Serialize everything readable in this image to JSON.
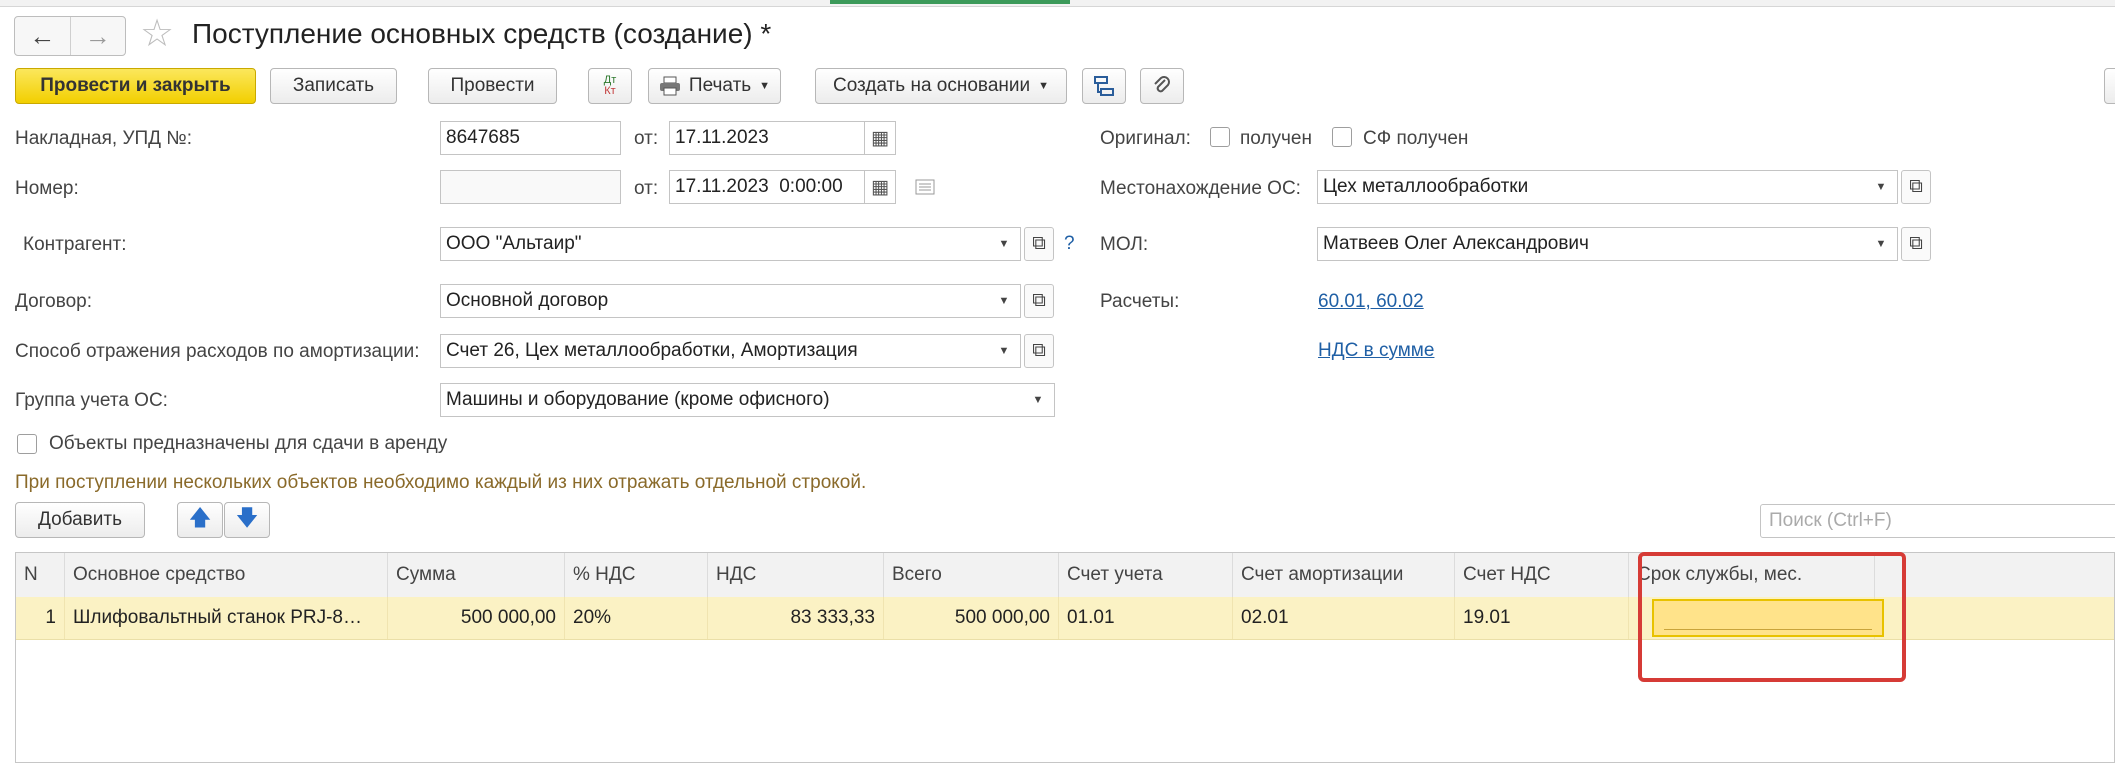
{
  "window": {
    "title": "Поступление основных средств (создание) *"
  },
  "toolbar": {
    "post_close": "Провести и закрыть",
    "save": "Записать",
    "post": "Провести",
    "dtkt_top": "Дт",
    "dtkt_bottom": "Кт",
    "print": "Печать",
    "create_based": "Создать на основании"
  },
  "form": {
    "invoice_label": "Накладная, УПД №:",
    "invoice_value": "8647685",
    "from_label": "от:",
    "invoice_date": "17.11.2023",
    "number_label": "Номер:",
    "number_value": "",
    "number_date": "17.11.2023  0:00:00",
    "counterparty_label": "Контрагент:",
    "counterparty_value": "ООО \"Альтаир\"",
    "question": "?",
    "contract_label": "Договор:",
    "contract_value": "Основной договор",
    "amort_label": "Способ отражения расходов по амортизации:",
    "amort_value": "Счет 26, Цех металлообработки, Амортизация",
    "group_label": "Группа учета ОС:",
    "group_value": "Машины и оборудование (кроме офисного)",
    "rent_label": "Объекты предназначены для сдачи в аренду",
    "original_label": "Оригинал:",
    "received_label": "получен",
    "sf_received_label": "СФ получен",
    "location_label": "Местонахождение ОС:",
    "location_value": "Цех металлообработки",
    "mol_label": "МОЛ:",
    "mol_value": "Матвеев Олег Александрович",
    "settlements_label": "Расчеты:",
    "settlements_link": "60.01, 60.02",
    "vat_link": "НДС в сумме"
  },
  "hint": "При поступлении нескольких объектов необходимо каждый из них отражать отдельной строкой.",
  "table_toolbar": {
    "add": "Добавить",
    "search_placeholder": "Поиск (Ctrl+F)"
  },
  "table": {
    "headers": [
      "N",
      "Основное средство",
      "Сумма",
      "% НДС",
      "НДС",
      "Всего",
      "Счет учета",
      "Счет амортизации",
      "Счет НДС",
      "Срок службы, мес."
    ],
    "rows": [
      [
        "1",
        "Шлифовальтный станок PRJ-8…",
        "500 000,00",
        "20%",
        "83 333,33",
        "500 000,00",
        "01.01",
        "02.01",
        "19.01",
        ""
      ]
    ]
  },
  "colors": {
    "primary_button": "#f2cf00",
    "selected_row": "#fbf2c4",
    "highlight_frame": "#d63b36",
    "link": "#1f5fa5"
  }
}
